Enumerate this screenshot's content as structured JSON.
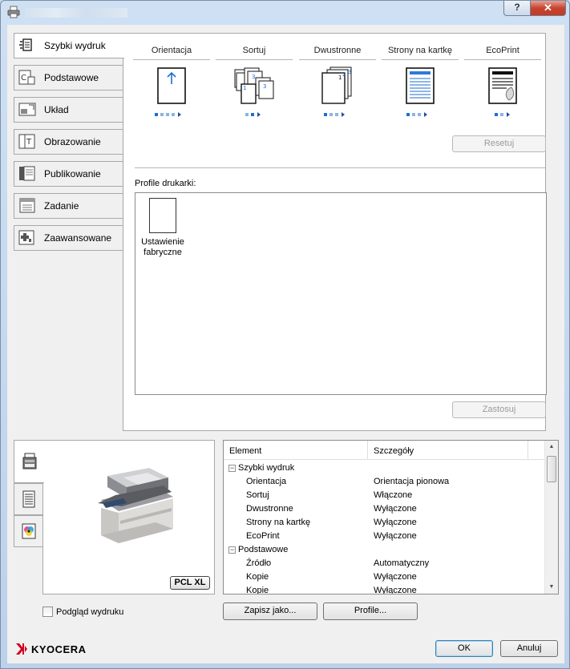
{
  "window": {
    "help_label": "?",
    "close_label": "✕"
  },
  "tabs": [
    {
      "label": "Szybki wydruk",
      "icon": "quick-print-icon"
    },
    {
      "label": "Podstawowe",
      "icon": "basic-icon"
    },
    {
      "label": "Układ",
      "icon": "layout-icon"
    },
    {
      "label": "Obrazowanie",
      "icon": "imaging-icon"
    },
    {
      "label": "Publikowanie",
      "icon": "publishing-icon"
    },
    {
      "label": "Zadanie",
      "icon": "job-icon"
    },
    {
      "label": "Zaawansowane",
      "icon": "advanced-icon"
    }
  ],
  "quick_print": {
    "items": [
      {
        "label": "Orientacja",
        "icon": "orientation-icon"
      },
      {
        "label": "Sortuj",
        "icon": "collate-icon"
      },
      {
        "label": "Dwustronne",
        "icon": "duplex-icon"
      },
      {
        "label": "Strony na kartkę",
        "icon": "pages-per-sheet-icon"
      },
      {
        "label": "EcoPrint",
        "icon": "ecoprint-icon"
      }
    ],
    "reset_label": "Resetuj",
    "profiles_label": "Profile drukarki:",
    "profile_tile_line1": "Ustawienie",
    "profile_tile_line2": "fabryczne",
    "apply_label": "Zastosuj"
  },
  "preview": {
    "badge": "PCL XL",
    "print_preview_label": "Podgląd wydruku",
    "print_preview_checked": false
  },
  "details": {
    "columns": [
      "Element",
      "Szczegóły"
    ],
    "rows": [
      {
        "type": "group",
        "expander": "−",
        "c1": "Szybki wydruk",
        "c2": ""
      },
      {
        "type": "item",
        "c1": "Orientacja",
        "c2": "Orientacja pionowa"
      },
      {
        "type": "item",
        "c1": "Sortuj",
        "c2": "Włączone"
      },
      {
        "type": "item",
        "c1": "Dwustronne",
        "c2": "Wyłączone"
      },
      {
        "type": "item",
        "c1": "Strony na kartkę",
        "c2": "Wyłączone"
      },
      {
        "type": "item",
        "c1": "EcoPrint",
        "c2": "Wyłączone"
      },
      {
        "type": "group",
        "expander": "−",
        "c1": "Podstawowe",
        "c2": ""
      },
      {
        "type": "item",
        "c1": "Źródło",
        "c2": "Automatyczny"
      },
      {
        "type": "item",
        "c1": "Kopie",
        "c2": "Wyłączone"
      },
      {
        "type": "item",
        "c1": "Kopie",
        "c2": "Wyłączone"
      }
    ]
  },
  "buttons": {
    "save_as": "Zapisz jako...",
    "profile": "Profile...",
    "ok": "OK",
    "cancel": "Anuluj"
  },
  "brand": {
    "name": "KYOCERA",
    "color": "#d2001e"
  }
}
